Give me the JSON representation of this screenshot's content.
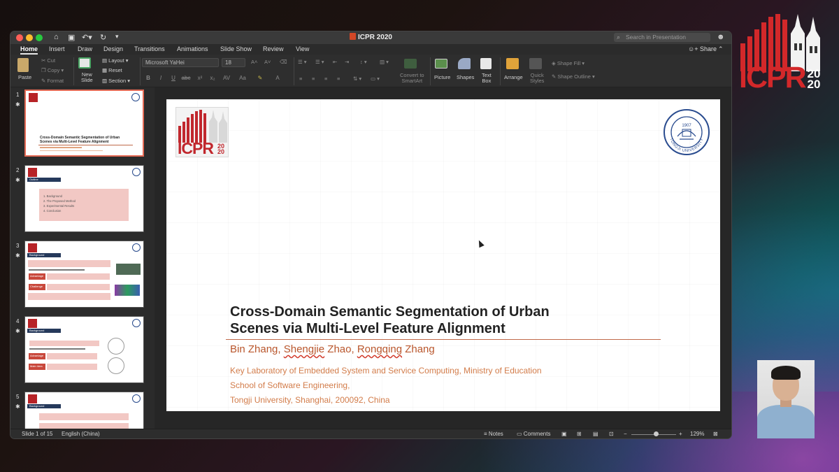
{
  "overlay": {
    "corner_logo": {
      "letters": "ICPR",
      "year_top": "20",
      "year_bottom": "20",
      "colors": {
        "red": "#d3282a"
      }
    }
  },
  "window": {
    "title": "ICPR 2020",
    "search_placeholder": "Search in Presentation",
    "share_label": "Share",
    "tabs": [
      "Home",
      "Insert",
      "Draw",
      "Design",
      "Transitions",
      "Animations",
      "Slide Show",
      "Review",
      "View"
    ],
    "active_tab": "Home"
  },
  "ribbon": {
    "paste": "Paste",
    "cut": "Cut",
    "copy": "Copy",
    "format": "Format",
    "new_slide_line1": "New",
    "new_slide_line2": "Slide",
    "layout": "Layout",
    "reset": "Reset",
    "section": "Section",
    "font_name": "Microsoft YaHei",
    "font_size": "18",
    "convert_line1": "Convert to",
    "convert_line2": "SmartArt",
    "picture": "Picture",
    "shapes": "Shapes",
    "textbox_line1": "Text",
    "textbox_line2": "Box",
    "arrange": "Arrange",
    "quick_styles_line1": "Quick",
    "quick_styles_line2": "Styles",
    "shape_fill": "Shape Fill",
    "shape_outline": "Shape Outline"
  },
  "thumbnails": [
    {
      "number": "1",
      "kind": "title",
      "title_line1": "Cross-Domain Semantic Segmentation of Urban",
      "title_line2": "Scenes via Multi-Level Feature Alignment"
    },
    {
      "number": "2",
      "kind": "outline",
      "tag": "Outline",
      "items": [
        "1.  Background",
        "2.  The Proposed Method",
        "3.  Experimental Results",
        "4.  Conclusion"
      ]
    },
    {
      "number": "3",
      "kind": "background",
      "tag": "Background",
      "labels": [
        "Advantage",
        "Challenge"
      ]
    },
    {
      "number": "4",
      "kind": "background",
      "tag": "Background",
      "labels": [
        "Advantage",
        "Main Idea"
      ]
    },
    {
      "number": "5",
      "kind": "background",
      "tag": "Background"
    }
  ],
  "slide": {
    "logo_letters": "ICPR",
    "logo_year_top": "20",
    "logo_year_bottom": "20",
    "seal_year": "1907",
    "seal_text": "TONGJI UNIVERSITY",
    "title_line1": "Cross-Domain Semantic Segmentation of Urban",
    "title_line2": "Scenes via Multi-Level Feature Alignment",
    "author_1": "Bin Zhang, ",
    "author_2": "Shengjie",
    "author_2_rest": " Zhao, ",
    "author_3": "Rongqing",
    "author_3_rest": " Zhang",
    "affiliation_1": "Key Laboratory of Embedded System and Service Computing, Ministry of Education",
    "affiliation_2": "School of Software Engineering,",
    "affiliation_3": "Tongji University, Shanghai, 200092, China"
  },
  "statusbar": {
    "slide_count": "Slide 1 of 15",
    "language": "English (China)",
    "notes": "Notes",
    "comments": "Comments",
    "zoom": "129%"
  }
}
